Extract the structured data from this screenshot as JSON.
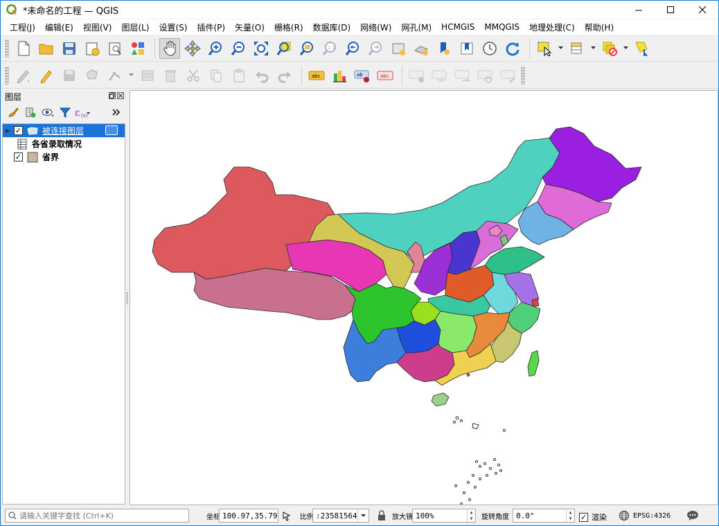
{
  "window": {
    "title": "*未命名的工程 — QGIS",
    "controls": [
      "minimize",
      "maximize",
      "close"
    ]
  },
  "menubar": {
    "items": [
      "工程(J)",
      "编辑(E)",
      "视图(V)",
      "图层(L)",
      "设置(S)",
      "插件(P)",
      "矢量(O)",
      "栅格(R)",
      "数据库(D)",
      "网络(W)",
      "网孔(M)",
      "HCMGIS",
      "MMQGIS",
      "地理处理(C)",
      "帮助(H)"
    ]
  },
  "layers_panel": {
    "title": "图层",
    "layers": [
      {
        "name": "被连接图层",
        "checked": true,
        "selected": true,
        "icon": "polygon-layer-icon"
      },
      {
        "name": "各省录取情况",
        "checked": null,
        "selected": false,
        "icon": "table-layer-icon"
      },
      {
        "name": "省界",
        "checked": true,
        "selected": false,
        "icon": "polygon-fill-swatch",
        "swatch_color": "#c8b89a"
      }
    ]
  },
  "statusbar": {
    "locator_placeholder": "请输入关键字查找 (Ctrl+K)",
    "coordinate_label": "坐标",
    "coordinate": "100.97,35.79",
    "scale_label": "比例",
    "scale": ":23581564",
    "magnifier_label": "放大镜",
    "magnifier": "100%",
    "rotation_label": "旋转角度",
    "rotation": "0.0°",
    "render_label": "渲染",
    "render_checked": true,
    "crs": "EPSG:4326"
  },
  "colors": {
    "selection": "#1a73d9",
    "title_accent": "#1979ca"
  }
}
